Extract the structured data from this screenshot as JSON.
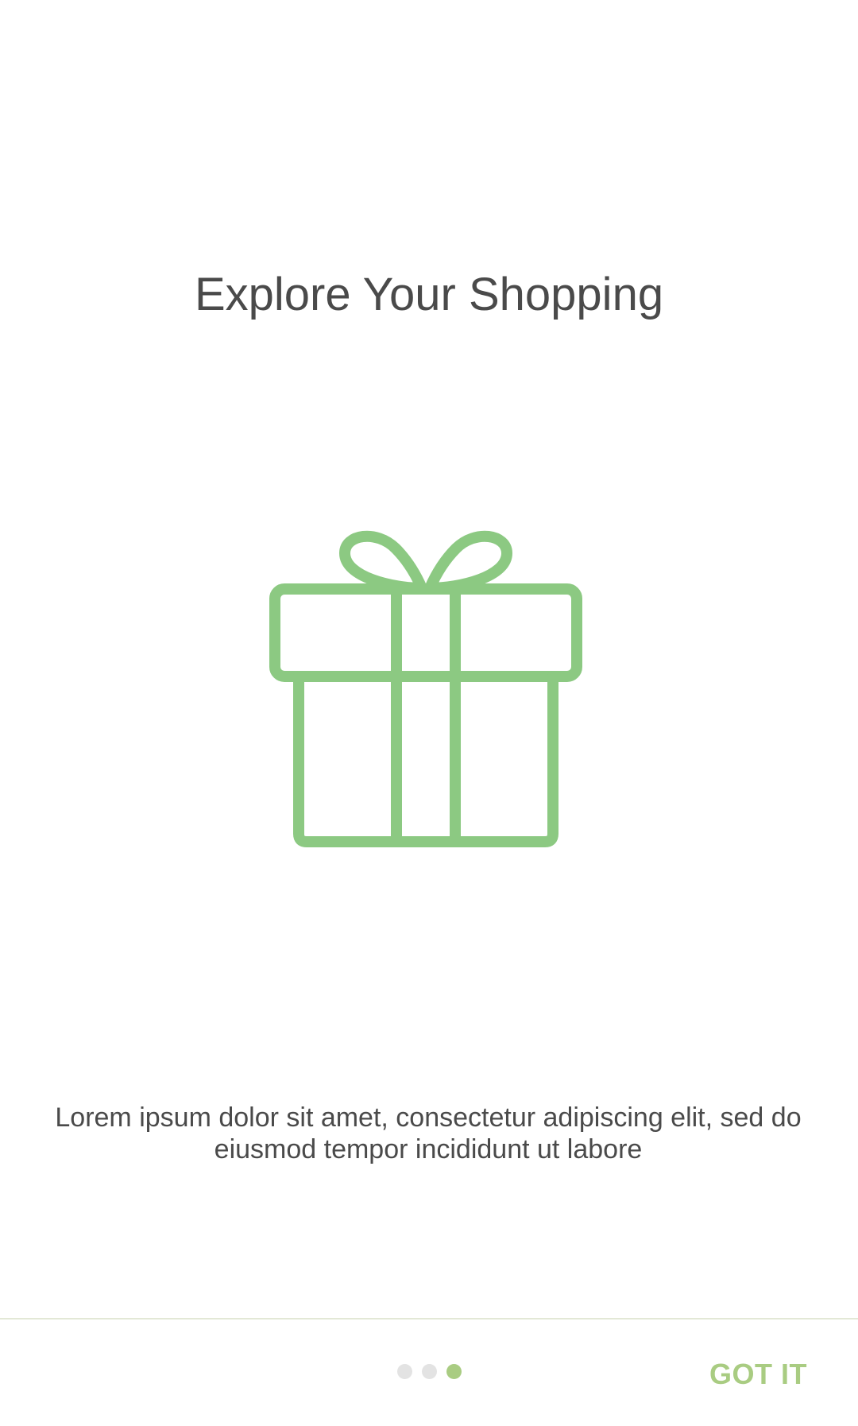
{
  "title": "Explore Your Shopping",
  "image": {
    "icon": "gift-icon",
    "color": "#8CC982"
  },
  "description": {
    "line1": "Lorem ipsum dolor sit amet, consectetur adipiscing elit, sed do",
    "line2": "eiusmod tempor incididunt ut labore"
  },
  "pager": {
    "total": 3,
    "active_index": 2,
    "active_color": "#A9CC82",
    "inactive_color": "#E3E3E3"
  },
  "actions": {
    "got_it_label": "GOT IT"
  }
}
